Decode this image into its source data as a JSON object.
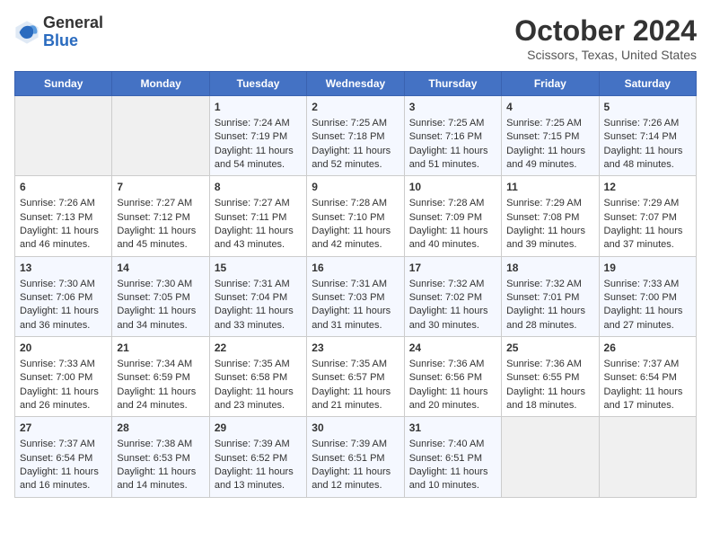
{
  "header": {
    "logo_general": "General",
    "logo_blue": "Blue",
    "title": "October 2024",
    "subtitle": "Scissors, Texas, United States"
  },
  "days_of_week": [
    "Sunday",
    "Monday",
    "Tuesday",
    "Wednesday",
    "Thursday",
    "Friday",
    "Saturday"
  ],
  "weeks": [
    [
      {
        "day": "",
        "sunrise": "",
        "sunset": "",
        "daylight": ""
      },
      {
        "day": "",
        "sunrise": "",
        "sunset": "",
        "daylight": ""
      },
      {
        "day": "1",
        "sunrise": "Sunrise: 7:24 AM",
        "sunset": "Sunset: 7:19 PM",
        "daylight": "Daylight: 11 hours and 54 minutes."
      },
      {
        "day": "2",
        "sunrise": "Sunrise: 7:25 AM",
        "sunset": "Sunset: 7:18 PM",
        "daylight": "Daylight: 11 hours and 52 minutes."
      },
      {
        "day": "3",
        "sunrise": "Sunrise: 7:25 AM",
        "sunset": "Sunset: 7:16 PM",
        "daylight": "Daylight: 11 hours and 51 minutes."
      },
      {
        "day": "4",
        "sunrise": "Sunrise: 7:25 AM",
        "sunset": "Sunset: 7:15 PM",
        "daylight": "Daylight: 11 hours and 49 minutes."
      },
      {
        "day": "5",
        "sunrise": "Sunrise: 7:26 AM",
        "sunset": "Sunset: 7:14 PM",
        "daylight": "Daylight: 11 hours and 48 minutes."
      }
    ],
    [
      {
        "day": "6",
        "sunrise": "Sunrise: 7:26 AM",
        "sunset": "Sunset: 7:13 PM",
        "daylight": "Daylight: 11 hours and 46 minutes."
      },
      {
        "day": "7",
        "sunrise": "Sunrise: 7:27 AM",
        "sunset": "Sunset: 7:12 PM",
        "daylight": "Daylight: 11 hours and 45 minutes."
      },
      {
        "day": "8",
        "sunrise": "Sunrise: 7:27 AM",
        "sunset": "Sunset: 7:11 PM",
        "daylight": "Daylight: 11 hours and 43 minutes."
      },
      {
        "day": "9",
        "sunrise": "Sunrise: 7:28 AM",
        "sunset": "Sunset: 7:10 PM",
        "daylight": "Daylight: 11 hours and 42 minutes."
      },
      {
        "day": "10",
        "sunrise": "Sunrise: 7:28 AM",
        "sunset": "Sunset: 7:09 PM",
        "daylight": "Daylight: 11 hours and 40 minutes."
      },
      {
        "day": "11",
        "sunrise": "Sunrise: 7:29 AM",
        "sunset": "Sunset: 7:08 PM",
        "daylight": "Daylight: 11 hours and 39 minutes."
      },
      {
        "day": "12",
        "sunrise": "Sunrise: 7:29 AM",
        "sunset": "Sunset: 7:07 PM",
        "daylight": "Daylight: 11 hours and 37 minutes."
      }
    ],
    [
      {
        "day": "13",
        "sunrise": "Sunrise: 7:30 AM",
        "sunset": "Sunset: 7:06 PM",
        "daylight": "Daylight: 11 hours and 36 minutes."
      },
      {
        "day": "14",
        "sunrise": "Sunrise: 7:30 AM",
        "sunset": "Sunset: 7:05 PM",
        "daylight": "Daylight: 11 hours and 34 minutes."
      },
      {
        "day": "15",
        "sunrise": "Sunrise: 7:31 AM",
        "sunset": "Sunset: 7:04 PM",
        "daylight": "Daylight: 11 hours and 33 minutes."
      },
      {
        "day": "16",
        "sunrise": "Sunrise: 7:31 AM",
        "sunset": "Sunset: 7:03 PM",
        "daylight": "Daylight: 11 hours and 31 minutes."
      },
      {
        "day": "17",
        "sunrise": "Sunrise: 7:32 AM",
        "sunset": "Sunset: 7:02 PM",
        "daylight": "Daylight: 11 hours and 30 minutes."
      },
      {
        "day": "18",
        "sunrise": "Sunrise: 7:32 AM",
        "sunset": "Sunset: 7:01 PM",
        "daylight": "Daylight: 11 hours and 28 minutes."
      },
      {
        "day": "19",
        "sunrise": "Sunrise: 7:33 AM",
        "sunset": "Sunset: 7:00 PM",
        "daylight": "Daylight: 11 hours and 27 minutes."
      }
    ],
    [
      {
        "day": "20",
        "sunrise": "Sunrise: 7:33 AM",
        "sunset": "Sunset: 7:00 PM",
        "daylight": "Daylight: 11 hours and 26 minutes."
      },
      {
        "day": "21",
        "sunrise": "Sunrise: 7:34 AM",
        "sunset": "Sunset: 6:59 PM",
        "daylight": "Daylight: 11 hours and 24 minutes."
      },
      {
        "day": "22",
        "sunrise": "Sunrise: 7:35 AM",
        "sunset": "Sunset: 6:58 PM",
        "daylight": "Daylight: 11 hours and 23 minutes."
      },
      {
        "day": "23",
        "sunrise": "Sunrise: 7:35 AM",
        "sunset": "Sunset: 6:57 PM",
        "daylight": "Daylight: 11 hours and 21 minutes."
      },
      {
        "day": "24",
        "sunrise": "Sunrise: 7:36 AM",
        "sunset": "Sunset: 6:56 PM",
        "daylight": "Daylight: 11 hours and 20 minutes."
      },
      {
        "day": "25",
        "sunrise": "Sunrise: 7:36 AM",
        "sunset": "Sunset: 6:55 PM",
        "daylight": "Daylight: 11 hours and 18 minutes."
      },
      {
        "day": "26",
        "sunrise": "Sunrise: 7:37 AM",
        "sunset": "Sunset: 6:54 PM",
        "daylight": "Daylight: 11 hours and 17 minutes."
      }
    ],
    [
      {
        "day": "27",
        "sunrise": "Sunrise: 7:37 AM",
        "sunset": "Sunset: 6:54 PM",
        "daylight": "Daylight: 11 hours and 16 minutes."
      },
      {
        "day": "28",
        "sunrise": "Sunrise: 7:38 AM",
        "sunset": "Sunset: 6:53 PM",
        "daylight": "Daylight: 11 hours and 14 minutes."
      },
      {
        "day": "29",
        "sunrise": "Sunrise: 7:39 AM",
        "sunset": "Sunset: 6:52 PM",
        "daylight": "Daylight: 11 hours and 13 minutes."
      },
      {
        "day": "30",
        "sunrise": "Sunrise: 7:39 AM",
        "sunset": "Sunset: 6:51 PM",
        "daylight": "Daylight: 11 hours and 12 minutes."
      },
      {
        "day": "31",
        "sunrise": "Sunrise: 7:40 AM",
        "sunset": "Sunset: 6:51 PM",
        "daylight": "Daylight: 11 hours and 10 minutes."
      },
      {
        "day": "",
        "sunrise": "",
        "sunset": "",
        "daylight": ""
      },
      {
        "day": "",
        "sunrise": "",
        "sunset": "",
        "daylight": ""
      }
    ]
  ]
}
